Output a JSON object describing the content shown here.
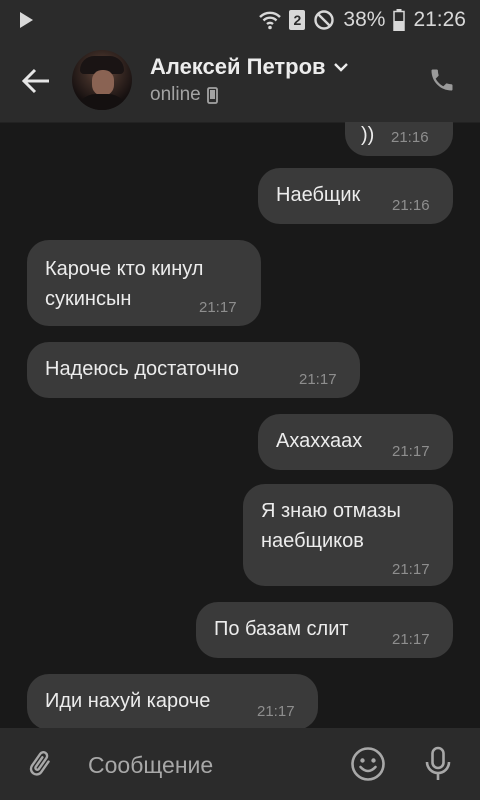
{
  "status_bar": {
    "battery": "38%",
    "time": "21:26",
    "sim": "2"
  },
  "header": {
    "contact_name": "Алексей Петров",
    "status": "online"
  },
  "messages": [
    {
      "text": "))",
      "time": "21:16",
      "outgoing": true
    },
    {
      "text": "Наебщик",
      "time": "21:16",
      "outgoing": true
    },
    {
      "text": "Кароче кто кинул\nсукинсын",
      "time": "21:17",
      "outgoing": false
    },
    {
      "text": "Надеюсь достаточно",
      "time": "21:17",
      "outgoing": false
    },
    {
      "text": "Ахаххаах",
      "time": "21:17",
      "outgoing": true
    },
    {
      "text": "Я знаю отмазы\nнаебщиков",
      "time": "21:17",
      "outgoing": true
    },
    {
      "text": "По базам слит",
      "time": "21:17",
      "outgoing": true
    },
    {
      "text": "Иди нахуй кароче",
      "time": "21:17",
      "outgoing": false
    }
  ],
  "input": {
    "placeholder": "Сообщение",
    "value": ""
  },
  "icons": {
    "back": "arrow-left-icon",
    "call": "phone-icon",
    "attach": "paperclip-icon",
    "emoji": "smiley-icon",
    "mic": "microphone-icon",
    "device": "mobile-device-icon",
    "dropdown": "chevron-down-icon"
  },
  "colors": {
    "background": "#191919",
    "bar": "#2b2b2b",
    "bubble": "#3a3a3a",
    "text": "#ececec",
    "secondary_text": "#a3a3a3"
  }
}
